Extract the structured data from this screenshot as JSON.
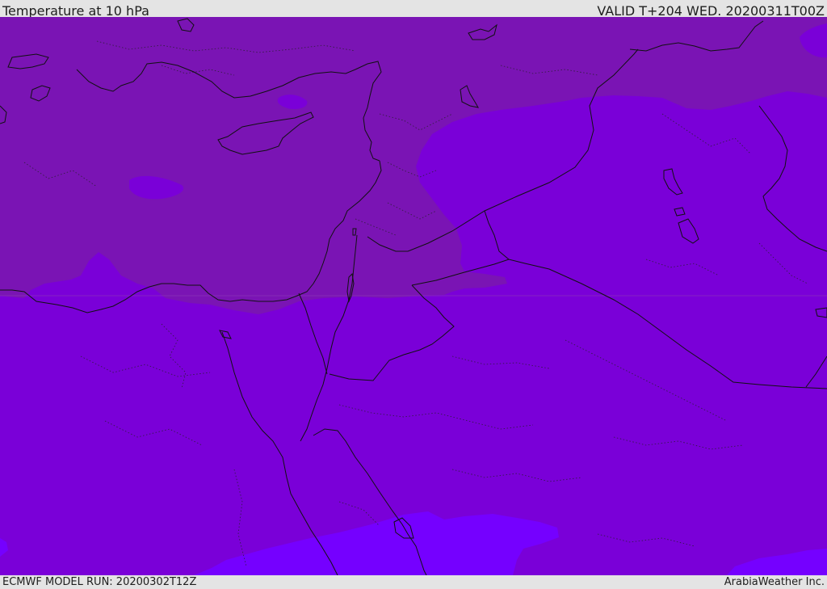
{
  "header": {
    "title": "Temperature at 10 hPa",
    "valid": "VALID T+204 WED. 20200311T00Z"
  },
  "footer": {
    "model_run": "ECMWF MODEL RUN: 20200302T12Z",
    "credit": "ArabiaWeather Inc."
  },
  "colors": {
    "band_warm": "#7a14b4",
    "band_mid": "#7a00d8",
    "band_cool": "#7500ff",
    "coastline": "#111111",
    "border": "#111111"
  }
}
